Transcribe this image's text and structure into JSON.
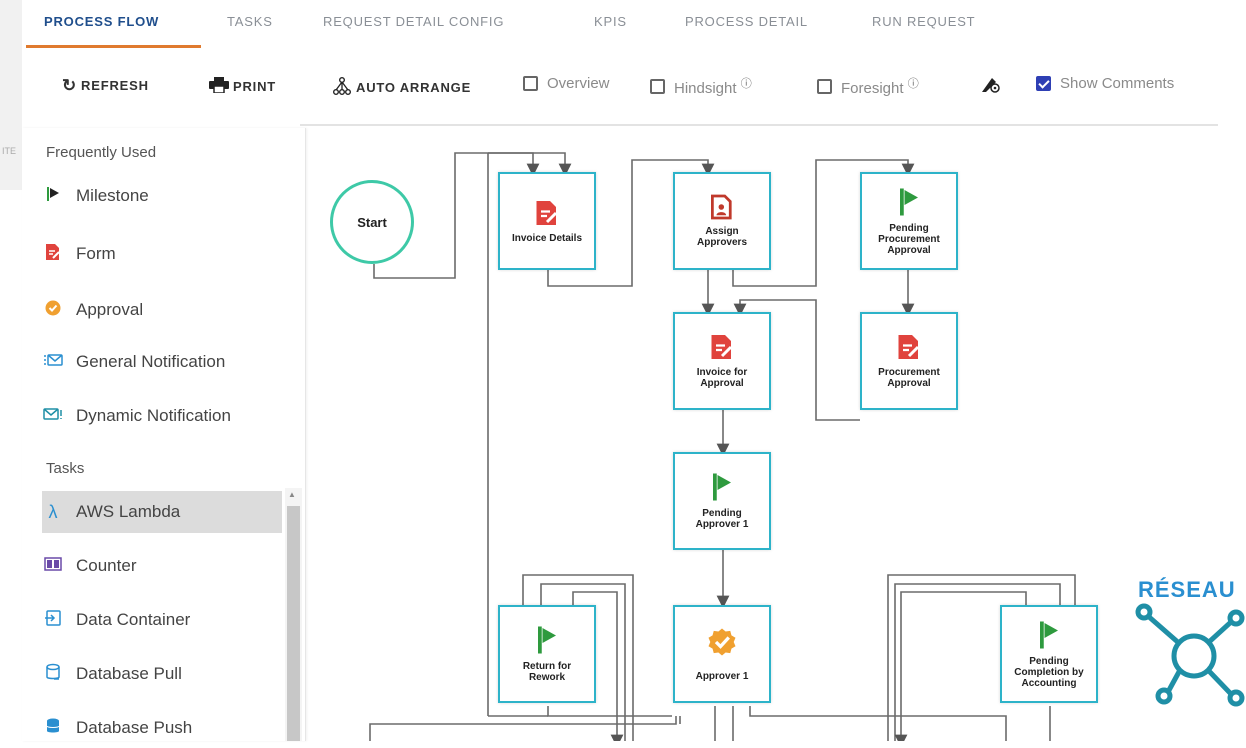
{
  "tabs": [
    {
      "label": "PROCESS FLOW",
      "active": true
    },
    {
      "label": "TASKS"
    },
    {
      "label": "REQUEST DETAIL CONFIG"
    },
    {
      "label": "KPIS"
    },
    {
      "label": "PROCESS DETAIL"
    },
    {
      "label": "RUN REQUEST"
    }
  ],
  "toolbar": {
    "refresh": "REFRESH",
    "print": "PRINT",
    "auto_arrange": "AUTO ARRANGE",
    "overview": "Overview",
    "hindsight": "Hindsight",
    "foresight": "Foresight",
    "show_comments": "Show Comments",
    "show_comments_checked": true
  },
  "left_stub_text": "ITE",
  "sidebar": {
    "frequently_used_title": "Frequently Used",
    "frequently_used": [
      {
        "label": "Milestone",
        "icon": "flag-icon"
      },
      {
        "label": "Form",
        "icon": "form-icon"
      },
      {
        "label": "Approval",
        "icon": "approval-badge-icon"
      },
      {
        "label": "General Notification",
        "icon": "notification-icon"
      },
      {
        "label": "Dynamic Notification",
        "icon": "email-icon"
      }
    ],
    "tasks_title": "Tasks",
    "tasks": [
      {
        "label": "AWS Lambda",
        "icon": "lambda-icon",
        "selected": true
      },
      {
        "label": "Counter",
        "icon": "counter-icon"
      },
      {
        "label": "Data Container",
        "icon": "data-container-icon"
      },
      {
        "label": "Database Pull",
        "icon": "database-pull-icon"
      },
      {
        "label": "Database Push",
        "icon": "database-push-icon"
      }
    ]
  },
  "flow": {
    "start": "Start",
    "nodes": {
      "invoice_details": "Invoice Details",
      "assign_approvers": "Assign Approvers",
      "pending_procurement_approval": "Pending Procurement Approval",
      "invoice_for_approval": "Invoice for Approval",
      "procurement_approval": "Procurement Approval",
      "pending_approver_1": "Pending Approver 1",
      "return_for_rework": "Return for Rework",
      "approver_1": "Approver 1",
      "pending_completion_by_accounting": "Pending Completion by Accounting"
    }
  },
  "watermark": "RÉSEAU",
  "colors": {
    "accent_tab": "#1f4e8c",
    "tab_underline": "#e07a2e",
    "node_border": "#2db3c9",
    "start_border": "#3ec9a7",
    "milestone_green": "#2e9a3e",
    "form_red": "#e0433d",
    "approval_orange": "#f0a030",
    "checkbox_blue": "#2e3fb4",
    "watermark_blue": "#2a8fd0"
  }
}
